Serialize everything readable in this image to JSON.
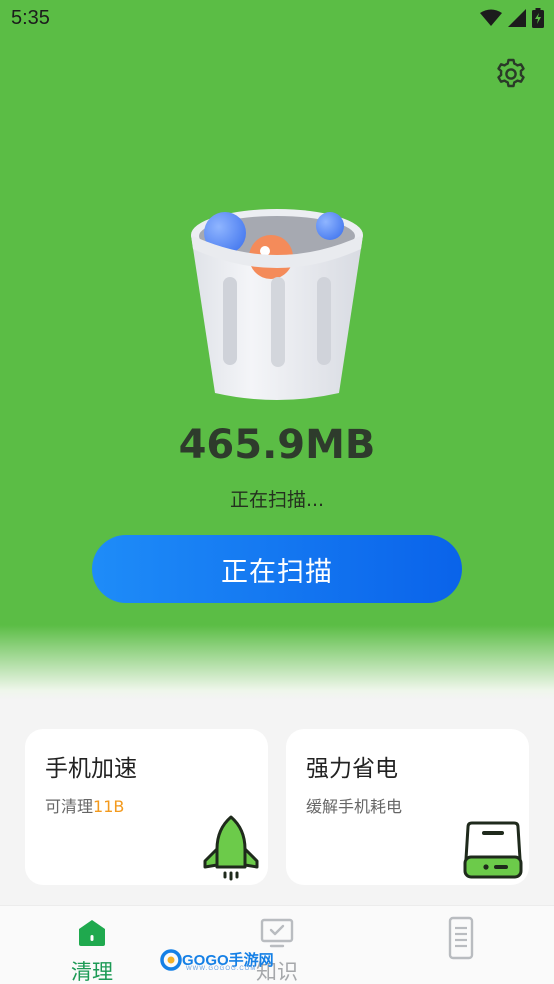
{
  "status_bar": {
    "time": "5:35"
  },
  "scan": {
    "size": "465.9MB",
    "status": "正在扫描...",
    "button_label": "正在扫描"
  },
  "cards": [
    {
      "title": "手机加速",
      "subtitle_prefix": "可清理",
      "subtitle_value": "11B",
      "icon": "rocket-icon"
    },
    {
      "title": "强力省电",
      "subtitle": "缓解手机耗电",
      "icon": "battery-icon"
    }
  ],
  "tabs": [
    {
      "label": "清理",
      "icon": "home-icon",
      "active": true
    },
    {
      "label": "知识",
      "icon": "monitor-icon",
      "active": false
    },
    {
      "label": "",
      "icon": "phone-icon",
      "active": false
    }
  ],
  "watermark": {
    "text": "GOGO手游网",
    "sub": "WWW.GOGOG.COM"
  },
  "colors": {
    "hero_green": "#5bbd45",
    "button_blue": "#1e8cf8",
    "accent_orange": "#f39a1e",
    "tab_active": "#1c9a55",
    "card_icon_green": "#6ccb4a"
  }
}
